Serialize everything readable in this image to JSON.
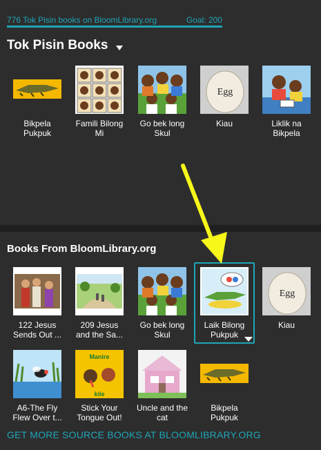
{
  "header": {
    "count_text": "776 Tok Pisin books on BloomLibrary.org",
    "goal_text": "Goal: 200"
  },
  "collection": {
    "title": "Tok Pisin Books",
    "books": [
      {
        "title": "Bikpela Pukpuk",
        "icon": "crocodile-cover"
      },
      {
        "title": "Famili Bilong Mi",
        "icon": "family-grid-cover"
      },
      {
        "title": "Go bek long Skul",
        "icon": "children-cover"
      },
      {
        "title": "Kiau",
        "icon": "egg-cover"
      },
      {
        "title": "Liklik na Bikpela",
        "icon": "reading-cover"
      }
    ]
  },
  "source": {
    "title": "Books From BloomLibrary.org",
    "books": [
      {
        "title": "122 Jesus Sends Out ...",
        "icon": "jesus-cover"
      },
      {
        "title": "209 Jesus and the Sa...",
        "icon": "landscape-cover"
      },
      {
        "title": "Go bek long Skul",
        "icon": "children-cover"
      },
      {
        "title": "Laik Bilong Pukpuk",
        "icon": "crocodile-dream-cover"
      },
      {
        "title": "Kiau",
        "icon": "egg-cover"
      },
      {
        "title": "A6-The Fly Flew Over t...",
        "icon": "fly-cover"
      },
      {
        "title": "Stick Your Tongue Out!",
        "icon": "tongue-cover"
      },
      {
        "title": "Uncle and the cat",
        "icon": "house-cover"
      },
      {
        "title": "Bikpela Pukpuk",
        "icon": "crocodile-cover"
      }
    ],
    "cover_texts": {
      "egg": "Egg",
      "tongue_top": "Manire",
      "tongue_bottom": "kile"
    }
  },
  "footer": {
    "get_more": "GET MORE SOURCE BOOKS AT BLOOMLIBRARY.ORG"
  },
  "colors": {
    "accent": "#1fa6b8",
    "arrow": "#f7f71a",
    "background": "#2d2d2d"
  }
}
